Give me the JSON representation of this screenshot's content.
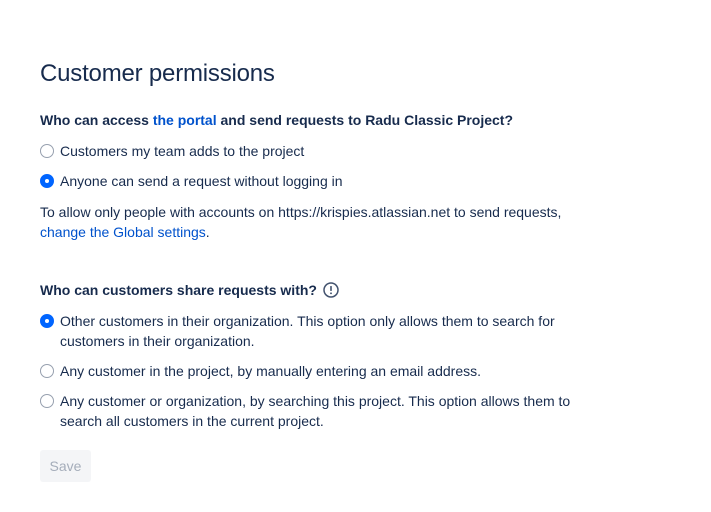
{
  "page": {
    "title": "Customer permissions"
  },
  "access": {
    "question_prefix": "Who can access ",
    "question_link": "the portal",
    "question_suffix": " and send requests to Radu Classic Project?",
    "options": [
      {
        "label": "Customers my team adds to the project",
        "selected": false
      },
      {
        "label": "Anyone can send a request without logging in",
        "selected": true
      }
    ],
    "note_text": "To allow only people with accounts on https://krispies.atlassian.net to send requests,",
    "note_link": "change the Global settings",
    "note_end": "."
  },
  "sharing": {
    "question": "Who can customers share requests with?",
    "info_icon": "info-circle-icon",
    "options": [
      {
        "label": "Other customers in their organization. This option only allows them to search for customers in their organization.",
        "selected": true
      },
      {
        "label": "Any customer in the project, by manually entering an email address.",
        "selected": false
      },
      {
        "label": "Any customer or organization, by searching this project. This option allows them to search all customers in the current project.",
        "selected": false
      }
    ]
  },
  "actions": {
    "save_label": "Save",
    "save_disabled": true
  },
  "colors": {
    "text": "#172B4D",
    "link": "#0052CC",
    "radio_selected": "#0065FF",
    "disabled_button_bg": "#F4F5F7",
    "disabled_button_text": "#A5ADBA"
  }
}
